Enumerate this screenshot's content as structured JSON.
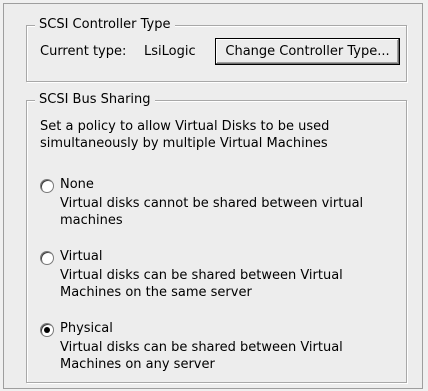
{
  "controller": {
    "legend": "SCSI Controller Type",
    "current_label": "Current type:",
    "current_value": "LsiLogic",
    "change_button": "Change Controller Type..."
  },
  "bus_sharing": {
    "legend": "SCSI Bus Sharing",
    "description": "Set a policy to allow Virtual Disks to be used simultaneously by multiple Virtual Machines",
    "options": [
      {
        "label": "None",
        "description": "Virtual disks cannot be shared between virtual machines",
        "selected": false
      },
      {
        "label": "Virtual",
        "description": "Virtual disks can be shared between Virtual Machines on the same server",
        "selected": false
      },
      {
        "label": "Physical",
        "description": "Virtual disks can be shared between Virtual Machines on any server",
        "selected": true
      }
    ]
  }
}
